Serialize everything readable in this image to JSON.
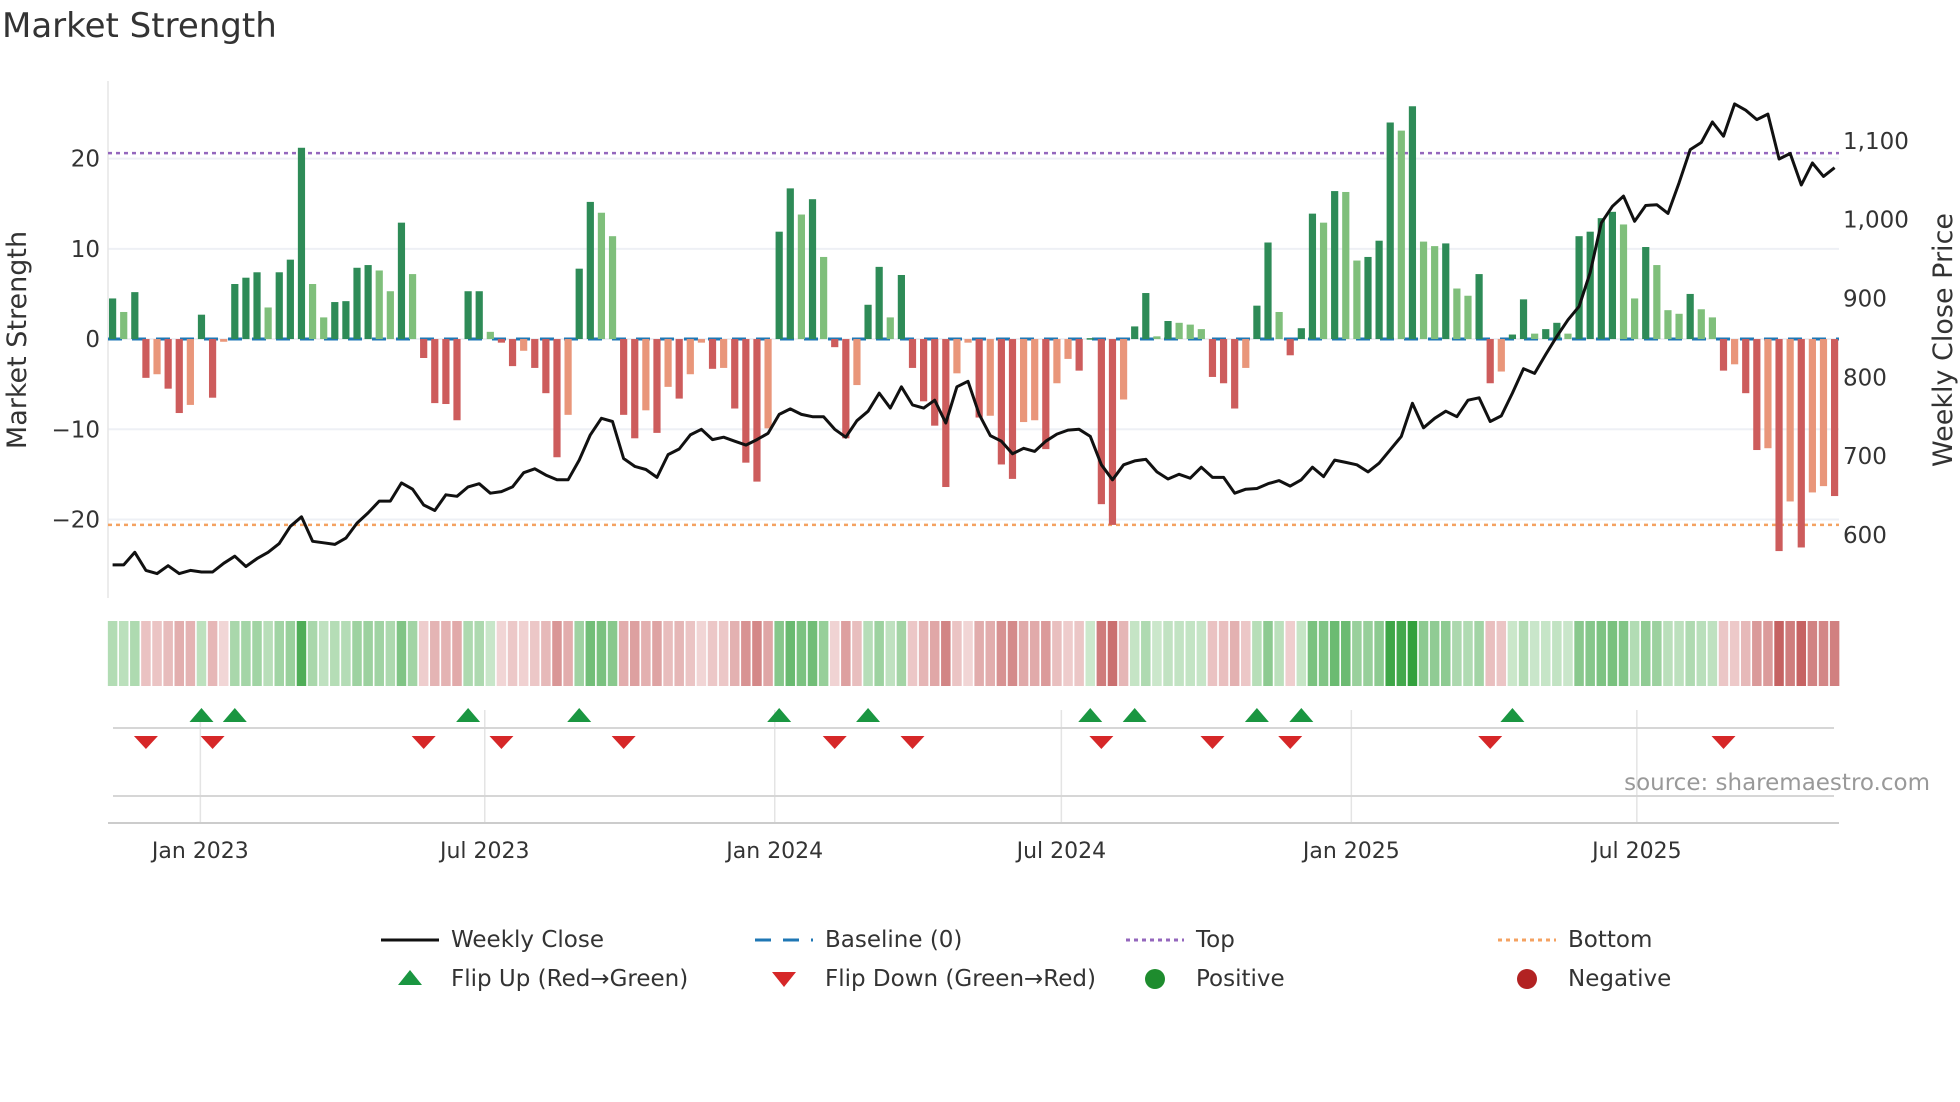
{
  "title": "Market Strength",
  "source": "source: sharemaestro.com",
  "colors": {
    "pos_strong": "#2e8b57",
    "pos_weak": "#7fbf7b",
    "neg_strong": "#cd5c5c",
    "neg_weak": "#e9967a",
    "line": "#111111",
    "baseline": "#1f77b4",
    "top": "#9467bd",
    "bottom": "#f4a261",
    "flip_up": "#1a9641",
    "flip_down": "#d62728",
    "positive": "#1e8c2e",
    "negative": "#b22222"
  },
  "legend": [
    {
      "label": "Weekly Close",
      "kind": "line"
    },
    {
      "label": "Baseline (0)",
      "kind": "baseline"
    },
    {
      "label": "Top",
      "kind": "top"
    },
    {
      "label": "Bottom",
      "kind": "bottom"
    },
    {
      "label": "Flip Up (Red→Green)",
      "kind": "up"
    },
    {
      "label": "Flip Down (Green→Red)",
      "kind": "down"
    },
    {
      "label": "Positive",
      "kind": "pos"
    },
    {
      "label": "Negative",
      "kind": "neg"
    }
  ],
  "chart_data": {
    "type": "bar",
    "title": "Market Strength",
    "ylabel": "Market Strength",
    "y2label": "Weekly Close Price",
    "ylim": [
      -28.7,
      28.6
    ],
    "y2lim": [
      520,
      1176
    ],
    "yticks": [
      20,
      10,
      0,
      -10,
      -20
    ],
    "ytick_labels": [
      "20",
      "10",
      "0",
      "−10",
      "−20"
    ],
    "y2ticks": [
      1100,
      1000,
      900,
      800,
      700,
      600
    ],
    "y2tick_labels": [
      "1,100",
      "1,000",
      "900",
      "800",
      "700",
      "600"
    ],
    "top_level": 20.6,
    "bottom_level": -20.6,
    "xticks": [
      {
        "label": "Jan 2023",
        "week": 7.9
      },
      {
        "label": "Jul 2023",
        "week": 33.5
      },
      {
        "label": "Jan 2024",
        "week": 59.6
      },
      {
        "label": "Jul 2024",
        "week": 85.4
      },
      {
        "label": "Jan 2025",
        "week": 111.5
      },
      {
        "label": "Jul 2025",
        "week": 137.2
      }
    ],
    "strength": [
      4.5,
      3.0,
      5.2,
      -4.3,
      -3.9,
      -5.5,
      -8.2,
      -7.3,
      2.7,
      -6.5,
      -0.3,
      6.1,
      6.8,
      7.4,
      3.5,
      7.4,
      8.8,
      21.2,
      6.1,
      2.4,
      4.1,
      4.2,
      7.9,
      8.2,
      7.6,
      5.3,
      12.9,
      7.2,
      -2.1,
      -7.1,
      -7.2,
      -9.0,
      5.3,
      5.3,
      0.8,
      -0.4,
      -3.0,
      -1.3,
      -3.2,
      -6.0,
      -13.1,
      -8.4,
      7.8,
      15.2,
      14.0,
      11.4,
      -8.4,
      -11.0,
      -7.9,
      -10.4,
      -5.3,
      -6.6,
      -3.9,
      -0.4,
      -3.3,
      -3.2,
      -7.7,
      -13.7,
      -15.8,
      -9.9,
      11.9,
      16.7,
      13.8,
      15.5,
      9.1,
      -0.9,
      -11.0,
      -5.1,
      3.8,
      8.0,
      2.4,
      7.1,
      -3.2,
      -6.9,
      -9.6,
      -16.4,
      -3.8,
      -0.4,
      -8.7,
      -8.5,
      -13.9,
      -15.5,
      -9.2,
      -9.0,
      -12.2,
      -4.9,
      -2.2,
      -3.5,
      0.1,
      -18.3,
      -20.6,
      -6.7,
      1.4,
      5.1,
      0.3,
      2.0,
      1.8,
      1.6,
      1.1,
      -4.2,
      -4.9,
      -7.7,
      -3.2,
      3.7,
      10.7,
      3.0,
      -1.8,
      1.2,
      13.9,
      12.9,
      16.4,
      16.3,
      8.7,
      9.1,
      10.9,
      24.0,
      23.1,
      25.8,
      10.8,
      10.3,
      10.6,
      5.6,
      4.8,
      7.2,
      -4.9,
      -3.6,
      0.5,
      4.4,
      0.6,
      1.1,
      1.8,
      0.6,
      11.4,
      11.9,
      13.4,
      14.1,
      12.7,
      4.5,
      10.2,
      8.2,
      3.2,
      2.8,
      5.0,
      3.3,
      2.4,
      -3.5,
      -2.8,
      -6.0,
      -12.3,
      -12.1,
      -23.5,
      -18.0,
      -23.1,
      -17.0,
      -16.3,
      -17.4
    ],
    "weekly_close": [
      562,
      562,
      578,
      555,
      551,
      561,
      551,
      555,
      553,
      553,
      564,
      573,
      560,
      570,
      578,
      589,
      611,
      623,
      592,
      590,
      588,
      596,
      615,
      628,
      643,
      643,
      666,
      658,
      638,
      631,
      651,
      649,
      661,
      665,
      653,
      655,
      661,
      679,
      684,
      676,
      670,
      670,
      695,
      727,
      748,
      744,
      697,
      687,
      683,
      673,
      702,
      709,
      727,
      734,
      721,
      724,
      719,
      714,
      721,
      729,
      753,
      760,
      753,
      750,
      750,
      734,
      724,
      745,
      757,
      780,
      761,
      788,
      765,
      761,
      771,
      742,
      788,
      795,
      753,
      726,
      719,
      703,
      710,
      706,
      719,
      728,
      733,
      734,
      725,
      689,
      670,
      689,
      694,
      696,
      680,
      671,
      677,
      672,
      686,
      673,
      673,
      653,
      658,
      659,
      665,
      669,
      662,
      670,
      686,
      674,
      695,
      692,
      689,
      680,
      691,
      708,
      725,
      767,
      736,
      748,
      757,
      750,
      771,
      774,
      744,
      751,
      780,
      811,
      805,
      829,
      852,
      873,
      890,
      933,
      996,
      1017,
      1030,
      998,
      1018,
      1019,
      1008,
      1047,
      1089,
      1098,
      1124,
      1106,
      1147,
      1139,
      1127,
      1134,
      1077,
      1084,
      1044,
      1072,
      1055,
      1066
    ],
    "flip_up_weeks": [
      8,
      11,
      32,
      42,
      60,
      68,
      88,
      92,
      103,
      107,
      126
    ],
    "flip_down_weeks": [
      3,
      9,
      28,
      35,
      46,
      65,
      72,
      89,
      99,
      106,
      124,
      145
    ]
  }
}
